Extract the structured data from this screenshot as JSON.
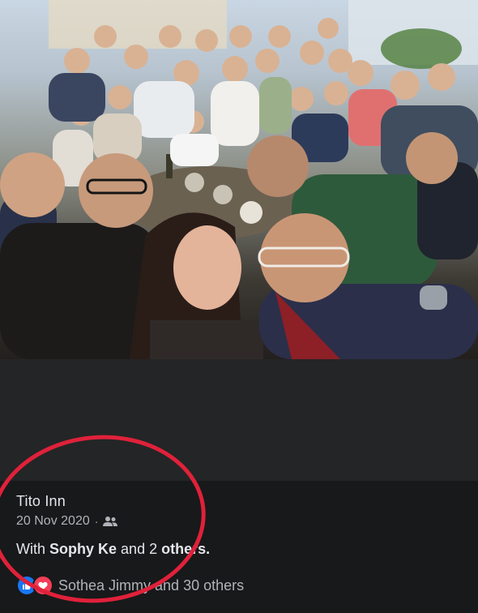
{
  "post": {
    "author": "Tito Inn",
    "date": "20 Nov 2020",
    "separator": "·",
    "audience_icon": "friends-icon",
    "with_prefix": "With",
    "tagged_name": "Sophy Ke",
    "with_middle": "and 2",
    "with_others": "others.",
    "reactions_text": "Sothea Jimmy and 30 others",
    "reaction_icons": [
      "like-icon",
      "love-icon"
    ]
  },
  "photo": {
    "description_icon": "group-selfie-photo"
  },
  "annotation": {
    "circle_color": "#e0213a"
  }
}
